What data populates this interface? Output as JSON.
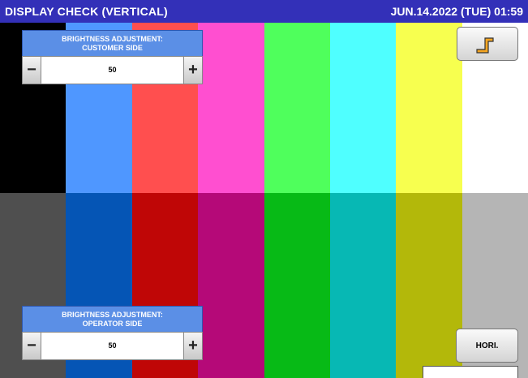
{
  "header": {
    "title": "DISPLAY CHECK (VERTICAL)",
    "datetime": "JUN.14.2022 (TUE)  01:59"
  },
  "color_bars": {
    "top": [
      "#000000",
      "#4f97ff",
      "#ff4f4f",
      "#ff4fd0",
      "#4fff5c",
      "#4fffff",
      "#f7ff4f",
      "#ffffff"
    ],
    "bottom": [
      "#4f4f4f",
      "#0555b5",
      "#bf0606",
      "#b50978",
      "#07ba16",
      "#07b8b4",
      "#b3b80a",
      "#b5b5b5"
    ]
  },
  "customer_panel": {
    "title": "BRIGHTNESS ADJUSTMENT:\nCUSTOMER SIDE",
    "value": "50",
    "minus": "−",
    "plus": "+"
  },
  "operator_panel": {
    "title": "BRIGHTNESS ADJUSTMENT:\nOPERATOR SIDE",
    "value": "50",
    "minus": "−",
    "plus": "+"
  },
  "back_button": {
    "icon": "return-arrow-icon"
  },
  "hori_button": {
    "label": "HORI."
  }
}
